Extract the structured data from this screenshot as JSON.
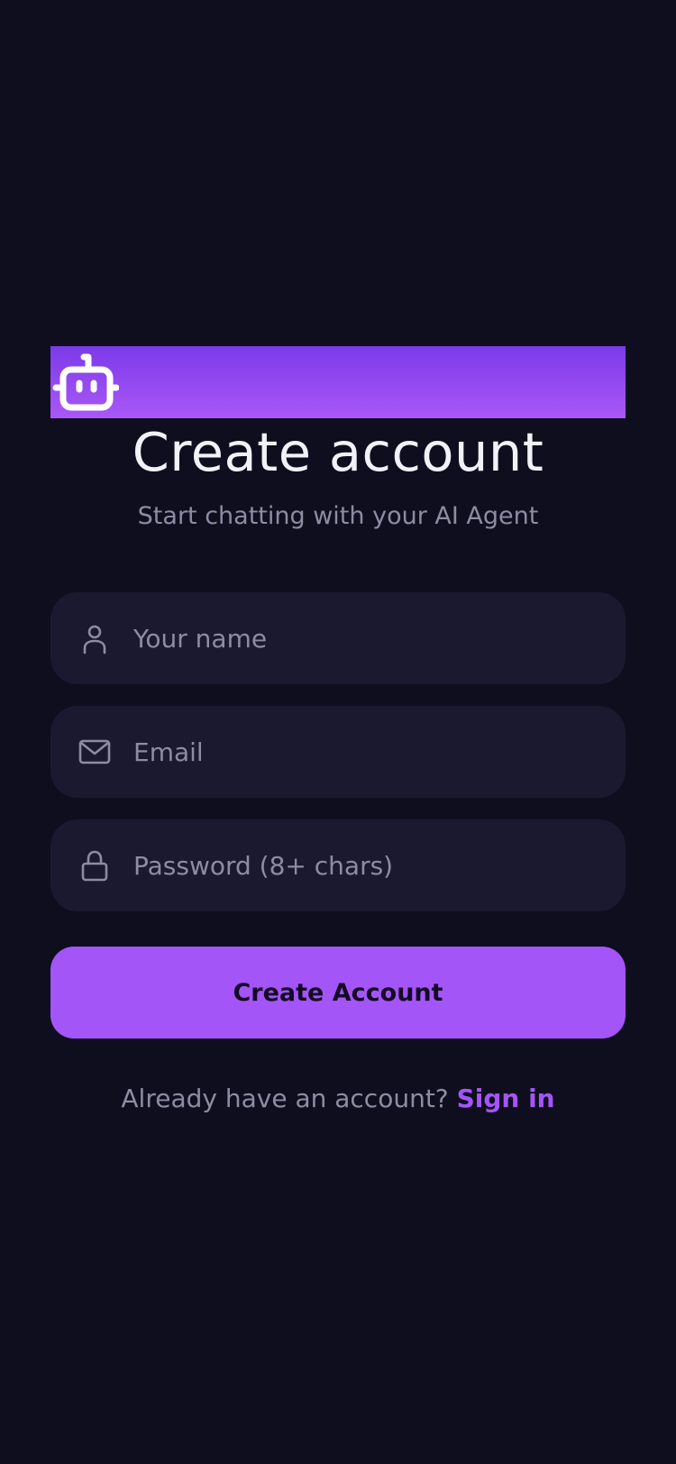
{
  "header": {
    "logo_icon": "robot-icon",
    "title": "Create account",
    "subtitle": "Start chatting with your AI Agent"
  },
  "form": {
    "name": {
      "icon": "user-icon",
      "placeholder": "Your name",
      "value": ""
    },
    "email": {
      "icon": "mail-icon",
      "placeholder": "Email",
      "value": ""
    },
    "password": {
      "icon": "lock-icon",
      "placeholder": "Password (8+ chars)",
      "value": ""
    },
    "submit_label": "Create Account"
  },
  "footer": {
    "prompt": "Already have an account?",
    "link_label": "Sign in"
  },
  "colors": {
    "background": "#0f0e1f",
    "field_background": "#1b1930",
    "accent": "#a455f7",
    "accent_dark": "#7b3ae8",
    "muted_text": "#8e8ca3",
    "title_text": "#f2f1f7"
  }
}
